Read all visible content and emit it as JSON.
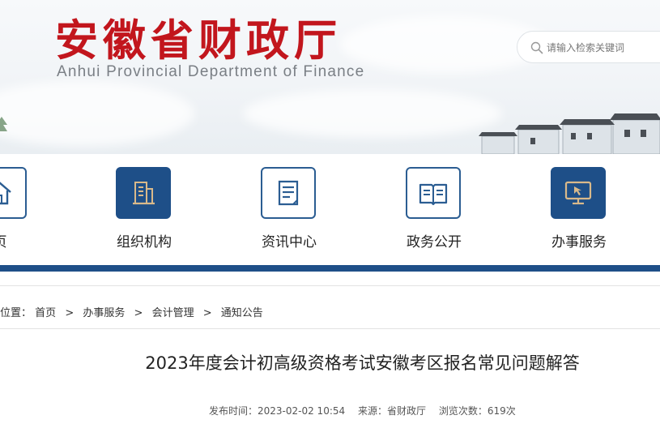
{
  "header": {
    "title": "安徽省财政厅",
    "subtitle": "Anhui Provincial Department of Finance",
    "title_color": "#c2161d"
  },
  "search": {
    "placeholder": "请输入检索关键词",
    "icon": "search-icon"
  },
  "nav": {
    "accent": "#1e4f88",
    "items": [
      {
        "label": "页",
        "icon": "home-icon",
        "active": false
      },
      {
        "label": "组织机构",
        "icon": "building-icon",
        "active": true
      },
      {
        "label": "资讯中心",
        "icon": "document-icon",
        "active": false
      },
      {
        "label": "政务公开",
        "icon": "open-book-icon",
        "active": false
      },
      {
        "label": "办事服务",
        "icon": "monitor-pointer-icon",
        "active": true
      }
    ]
  },
  "breadcrumb": {
    "prefix": "的位置：",
    "items": [
      "首页",
      "办事服务",
      "会计管理",
      "通知公告"
    ],
    "separator": ">"
  },
  "article": {
    "title": "2023年度会计初高级资格考试安徽考区报名常见问题解答",
    "publish_time": "发布时间：2023-02-02 10:54",
    "source": "来源：省财政厅",
    "views": "浏览次数：619次"
  }
}
